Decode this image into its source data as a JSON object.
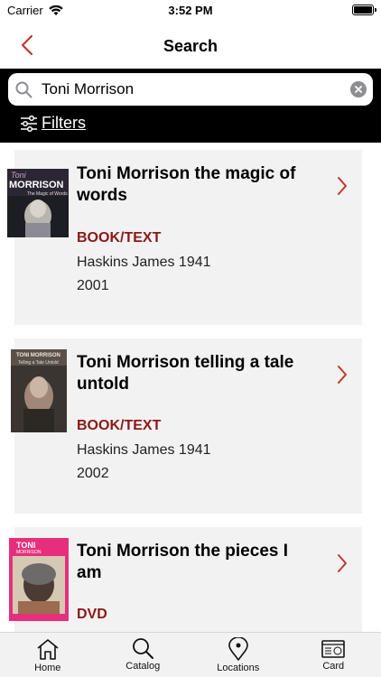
{
  "status_bar": {
    "carrier": "Carrier",
    "time": "3:52 PM"
  },
  "nav": {
    "title": "Search"
  },
  "search": {
    "value": "Toni Morrison"
  },
  "filters": {
    "label": "Filters"
  },
  "results": [
    {
      "title": "Toni Morrison the magic of words",
      "type": "BOOK/TEXT",
      "author": "Haskins James 1941",
      "year": "2001",
      "cover_text": [
        "Toni",
        "MORRISON",
        "The Magic of Words"
      ]
    },
    {
      "title": "Toni Morrison telling a tale untold",
      "type": "BOOK/TEXT",
      "author": "Haskins James 1941",
      "year": "2002",
      "cover_text": [
        "TONI MORRISON",
        "Telling a Tale Untold"
      ]
    },
    {
      "title": "Toni Morrison the pieces I am",
      "type": "DVD",
      "author": "",
      "year": "",
      "cover_text": [
        "TONI",
        "MORRISON"
      ]
    }
  ],
  "tabs": [
    {
      "label": "Home",
      "icon": "home-icon"
    },
    {
      "label": "Catalog",
      "icon": "search-icon"
    },
    {
      "label": "Locations",
      "icon": "location-pin-icon"
    },
    {
      "label": "Card",
      "icon": "library-card-icon"
    }
  ],
  "colors": {
    "accent": "#8a1818",
    "header_bg": "#000000",
    "card_bg": "#f3f2f2",
    "chevron": "#c0392b"
  }
}
